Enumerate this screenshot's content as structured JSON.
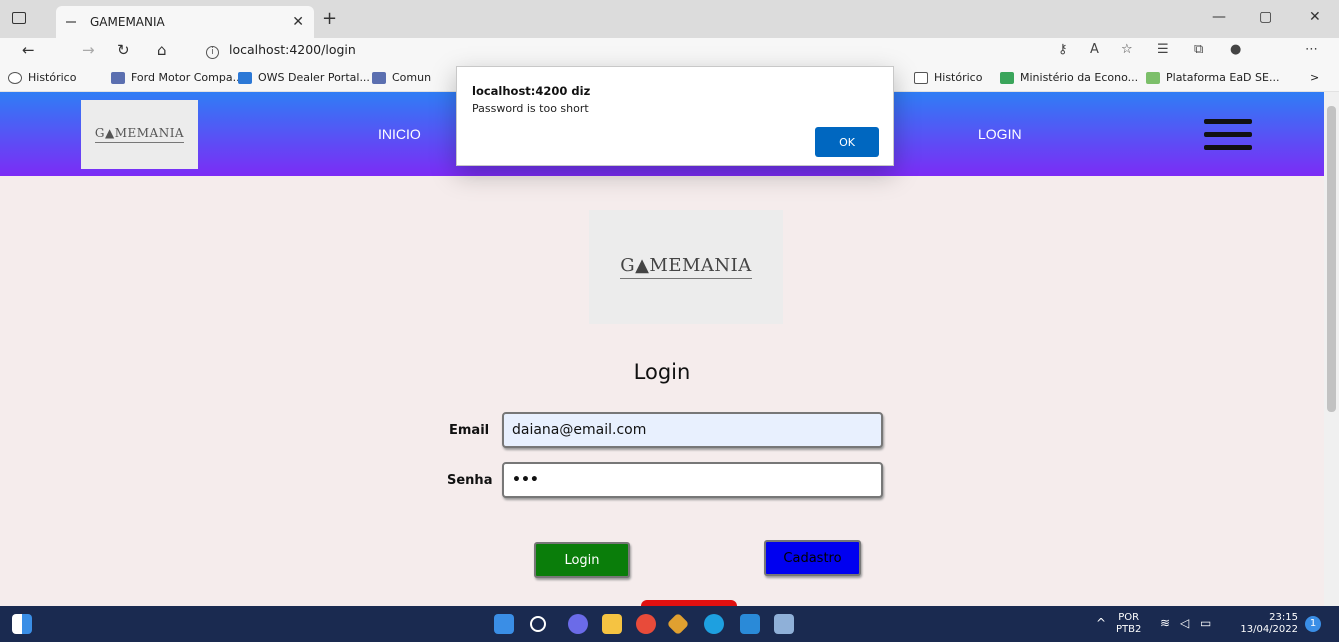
{
  "browser": {
    "tab_title": "GAMEMANIA",
    "url": "localhost:4200/login",
    "favorites": [
      {
        "label": "Histórico",
        "color": "#555555"
      },
      {
        "label": "Ford Motor Compa...",
        "color": "#5b6fb0"
      },
      {
        "label": "OWS Dealer Portal...",
        "color": "#2b78d6"
      },
      {
        "label": "Comun",
        "color": "#5b6fb0"
      },
      {
        "label": "Histórico",
        "color": "#555555"
      },
      {
        "label": "Ministério da Econo...",
        "color": "#3aa55b"
      },
      {
        "label": "Plataforma EaD SE...",
        "color": "#7cbf6a"
      }
    ]
  },
  "header": {
    "logo": "G▲MEMANIA",
    "links": [
      "INICIO",
      "LOGIN"
    ]
  },
  "page": {
    "logo": "G▲MEMANIA",
    "title": "Login",
    "email_label": "Email",
    "email_value": "daiana@email.com",
    "password_label": "Senha",
    "password_value": "•••",
    "login_button": "Login",
    "cadastro_button": "Cadastro"
  },
  "dialog": {
    "title": "localhost:4200 diz",
    "message": "Password is too short",
    "ok": "OK"
  },
  "taskbar": {
    "lang": "POR",
    "layout": "PTB2",
    "time": "23:15",
    "date": "13/04/2022",
    "notification_count": "1"
  }
}
